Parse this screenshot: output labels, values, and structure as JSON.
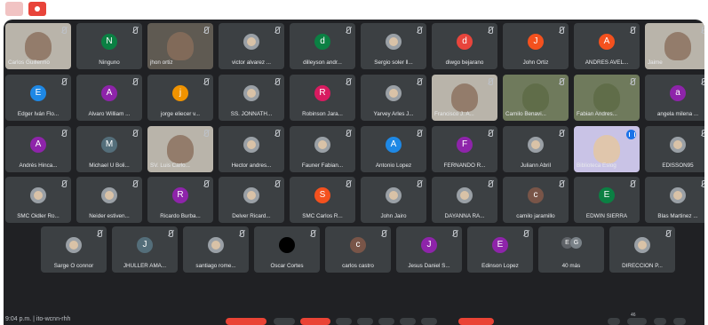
{
  "meeting": {
    "time": "9:04 p.m.",
    "code": "ito-wcnn-rhh",
    "overflow_badge": "46"
  },
  "colors": {
    "background": "#202124",
    "tile": "#3c4043",
    "speaking": "#1a73e8",
    "end_call": "#ea4335"
  },
  "rows": [
    [
      {
        "name": "Carlos Guillermo",
        "kind": "video",
        "style": "light"
      },
      {
        "name": "Ninguno",
        "avatar": "N",
        "color": "#0b8043"
      },
      {
        "name": "jhon ortiz",
        "kind": "video"
      },
      {
        "name": "victor alvarez ...",
        "avatar_icon": "photo"
      },
      {
        "name": "dilleyson andr...",
        "avatar": "d",
        "color": "#0b8043"
      },
      {
        "name": "Sergio soler ll...",
        "avatar_icon": "photo"
      },
      {
        "name": "diwgo bejarano",
        "avatar": "d",
        "color": "#e8453c"
      },
      {
        "name": "John Ortiz",
        "avatar": "J",
        "color": "#f4511e"
      },
      {
        "name": "ANDRES AVEL...",
        "avatar": "A",
        "color": "#f4511e"
      },
      {
        "name": "Jaime",
        "kind": "video",
        "style": "light"
      }
    ],
    [
      {
        "name": "Edger Iván Flo...",
        "avatar": "E",
        "color": "#1e88e5"
      },
      {
        "name": "Alvaro William ...",
        "avatar": "A",
        "color": "#8e24aa"
      },
      {
        "name": "jorge eliecer v...",
        "avatar": "j",
        "color": "#f09300"
      },
      {
        "name": "SS. JONNATH...",
        "avatar_icon": "photo"
      },
      {
        "name": "Robinson Jara...",
        "avatar": "R",
        "color": "#d81b60"
      },
      {
        "name": "Yarvey Arles J...",
        "avatar_icon": "photo"
      },
      {
        "name": "Francisco J. A...",
        "kind": "video",
        "style": "light"
      },
      {
        "name": "Camilo Benavi...",
        "kind": "video",
        "style": "green"
      },
      {
        "name": "Fabian Andres...",
        "kind": "video",
        "style": "green"
      },
      {
        "name": "angela milena ...",
        "avatar": "a",
        "color": "#8e24aa"
      }
    ],
    [
      {
        "name": "Andrés Hinca...",
        "avatar": "A",
        "color": "#8e24aa"
      },
      {
        "name": "Michael U Boli...",
        "avatar": "M",
        "color": "#546e7a"
      },
      {
        "name": "SV. Luis Carlo...",
        "kind": "video",
        "style": "light"
      },
      {
        "name": "Hector andres...",
        "avatar_icon": "photo"
      },
      {
        "name": "Fauner Fabian...",
        "avatar_icon": "photo"
      },
      {
        "name": "Antonio Lopez",
        "avatar": "A",
        "color": "#1e88e5"
      },
      {
        "name": "FERNANDO R...",
        "avatar": "F",
        "color": "#8e24aa"
      },
      {
        "name": "Juliann Abril",
        "avatar_icon": "photo"
      },
      {
        "name": "Biblioteca Eslog",
        "kind": "video",
        "style": "bright",
        "speaking": true
      },
      {
        "name": "EDISSON95",
        "avatar_icon": "photo"
      }
    ],
    [
      {
        "name": "SMC Oidler Ro...",
        "avatar_icon": "photo"
      },
      {
        "name": "Neider estiven...",
        "avatar_icon": "photo"
      },
      {
        "name": "Ricardo Burba...",
        "avatar": "R",
        "color": "#8e24aa"
      },
      {
        "name": "Delver Ricard...",
        "avatar_icon": "photo"
      },
      {
        "name": "SMC Carlos R...",
        "avatar": "S",
        "color": "#f4511e"
      },
      {
        "name": "John Jairo",
        "avatar_icon": "photo"
      },
      {
        "name": "DAYANNA RA...",
        "avatar_icon": "photo"
      },
      {
        "name": "camilo jaramillo",
        "avatar": "c",
        "color": "#795548"
      },
      {
        "name": "EDWIN SIERRA",
        "avatar": "E",
        "color": "#0b8043"
      },
      {
        "name": "Blas Martinez ...",
        "avatar_icon": "photo"
      }
    ],
    [
      {
        "name": "Sarge O connor",
        "avatar_icon": "photo"
      },
      {
        "name": "JHULLER AMA...",
        "avatar": "J",
        "color": "#546e7a"
      },
      {
        "name": "santiago rome...",
        "avatar_icon": "photo"
      },
      {
        "name": "Oscar Cortes",
        "avatar_icon": "black"
      },
      {
        "name": "carlos castro",
        "avatar": "c",
        "color": "#795548"
      },
      {
        "name": "Jesus Daniel S...",
        "avatar": "J",
        "color": "#8e24aa"
      },
      {
        "name": "Edinson Lopez",
        "avatar": "E",
        "color": "#8e24aa"
      },
      {
        "name": "40 más",
        "kind": "more",
        "initials": [
          "E",
          "G"
        ]
      },
      {
        "name": "DIRECCIÓN P...",
        "avatar_icon": "photo"
      }
    ]
  ]
}
